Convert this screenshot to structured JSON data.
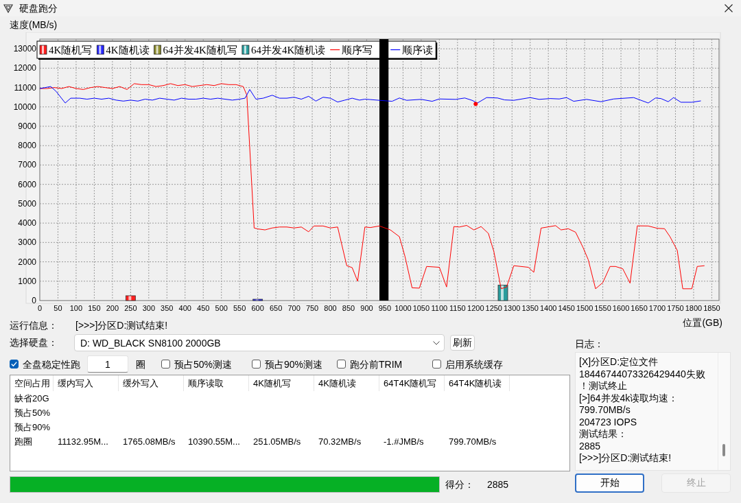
{
  "window": {
    "title": "硬盘跑分"
  },
  "chart": {
    "chart_data": [
      {
        "type": "line",
        "ylabel": "速度(MB/s)",
        "xlabel": "位置(GB)",
        "xlim": [
          0,
          1870
        ],
        "ylim": [
          0,
          13500
        ],
        "xticks": [
          0,
          50,
          100,
          150,
          200,
          250,
          300,
          350,
          400,
          450,
          500,
          550,
          600,
          650,
          700,
          750,
          800,
          850,
          900,
          950,
          1000,
          1050,
          1100,
          1150,
          1200,
          1250,
          1300,
          1350,
          1400,
          1450,
          1500,
          1550,
          1600,
          1650,
          1700,
          1750,
          1800,
          1850
        ],
        "yticks": [
          0,
          1000,
          2000,
          3000,
          4000,
          5000,
          6000,
          7000,
          8000,
          9000,
          10000,
          11000,
          12000,
          13000
        ],
        "grid": true,
        "legend": "top-left",
        "bands": [
          {
            "axis": "x",
            "from": 935,
            "to": 960,
            "color": "#000000"
          }
        ],
        "series": [
          {
            "name": "4K随机写",
            "type": "bar",
            "color": "#ff2020",
            "x": [
              250
            ],
            "values": [
              250
            ]
          },
          {
            "name": "4K随机读",
            "type": "bar",
            "color": "#2828ff",
            "x": [
              600
            ],
            "values": [
              70
            ]
          },
          {
            "name": "64并发4K随机写",
            "type": "bar",
            "color": "#8c8c30"
          },
          {
            "name": "64并发4K随机读",
            "type": "bar",
            "color": "#2a9d9d",
            "x": [
              1275
            ],
            "values": [
              800
            ]
          },
          {
            "name": "顺序写",
            "color": "#ff0000",
            "x": [
              0,
              20,
              40,
              60,
              80,
              100,
              120,
              140,
              160,
              180,
              200,
              220,
              240,
              260,
              280,
              300,
              320,
              340,
              360,
              380,
              400,
              420,
              440,
              460,
              480,
              500,
              520,
              540,
              560,
              570,
              590,
              600,
              620,
              640,
              660,
              680,
              700,
              720,
              740,
              755,
              780,
              800,
              820,
              845,
              860,
              875,
              895,
              910,
              935,
              965,
              990,
              1005,
              1025,
              1045,
              1065,
              1100,
              1120,
              1140,
              1155,
              1175,
              1195,
              1215,
              1235,
              1250,
              1270,
              1285,
              1305,
              1345,
              1360,
              1380,
              1420,
              1435,
              1455,
              1475,
              1495,
              1510,
              1530,
              1550,
              1570,
              1585,
              1605,
              1625,
              1645,
              1675,
              1700,
              1720,
              1735,
              1755,
              1770,
              1795,
              1810,
              1830
            ],
            "values": [
              10950,
              10950,
              11000,
              10950,
              11050,
              10950,
              10900,
              11000,
              11050,
              11000,
              10950,
              11050,
              10900,
              11200,
              11150,
              11150,
              11050,
              11100,
              11200,
              11100,
              11150,
              11050,
              11100,
              11150,
              11100,
              11200,
              11150,
              11150,
              11050,
              10600,
              3750,
              3700,
              3650,
              3750,
              3800,
              3800,
              3750,
              3800,
              3550,
              3850,
              3850,
              3750,
              3800,
              1800,
              1700,
              1000,
              3800,
              3770,
              3850,
              3650,
              3300,
              2300,
              660,
              640,
              1760,
              1720,
              700,
              3820,
              3800,
              3880,
              3650,
              3820,
              3470,
              2530,
              610,
              700,
              1800,
              1720,
              1460,
              3740,
              3870,
              3650,
              3710,
              3530,
              2760,
              2110,
              610,
              930,
              1760,
              1760,
              1640,
              900,
              3860,
              3850,
              3730,
              3710,
              3300,
              2590,
              610,
              610,
              1760,
              1800
            ]
          },
          {
            "name": "顺序读",
            "color": "#0000ff",
            "x": [
              0,
              15,
              30,
              45,
              70,
              85,
              110,
              130,
              150,
              170,
              190,
              210,
              230,
              250,
              270,
              290,
              310,
              330,
              350,
              370,
              390,
              410,
              430,
              450,
              470,
              490,
              510,
              530,
              550,
              565,
              578,
              595,
              615,
              640,
              660,
              680,
              700,
              720,
              740,
              760,
              780,
              800,
              820,
              840,
              860,
              880,
              895,
              910,
              935,
              970,
              990,
              1010,
              1050,
              1080,
              1100,
              1145,
              1170,
              1190,
              1205,
              1230,
              1260,
              1280,
              1305,
              1350,
              1375,
              1405,
              1430,
              1450,
              1470,
              1505,
              1545,
              1580,
              1635,
              1675,
              1695,
              1710,
              1730,
              1745,
              1765,
              1795,
              1820
            ],
            "values": [
              10950,
              11000,
              11050,
              10800,
              10200,
              10450,
              10450,
              10400,
              10450,
              10400,
              10450,
              10350,
              10300,
              10350,
              10300,
              10400,
              10350,
              10450,
              10400,
              10350,
              10450,
              10400,
              10400,
              10450,
              10400,
              10450,
              10400,
              10350,
              10400,
              10450,
              10900,
              10400,
              10450,
              10600,
              10450,
              10450,
              10500,
              10400,
              10550,
              10300,
              10500,
              10450,
              10250,
              10350,
              10450,
              10350,
              10400,
              10380,
              10340,
              10290,
              10460,
              10340,
              10390,
              10290,
              10410,
              10390,
              10460,
              10340,
              10200,
              10480,
              10460,
              10360,
              10340,
              10480,
              10390,
              10430,
              10410,
              10480,
              10290,
              10390,
              10270,
              10410,
              10480,
              10200,
              10460,
              10430,
              10270,
              10480,
              10240,
              10240,
              10310
            ]
          },
          {
            "type": "scatter",
            "color": "#ff0000",
            "x": [
              1200
            ],
            "values": [
              10150
            ]
          }
        ]
      }
    ]
  },
  "run_info": {
    "label": "运行信息：",
    "value": "[>>>]分区D:测试结束!"
  },
  "disk_select": {
    "label": "选择硬盘：",
    "value": "D: WD_BLACK SN8100 2000GB"
  },
  "refresh_button": {
    "label": "刷新"
  },
  "run_options": {
    "full_disk": {
      "label": "全盘稳定性跑",
      "checked": true
    },
    "laps": {
      "value": "1",
      "unit": "圈"
    },
    "toggles": [
      {
        "label": "预占50%测速",
        "checked": false
      },
      {
        "label": "预占90%测速",
        "checked": false
      },
      {
        "label": "跑分前TRIM",
        "checked": false
      },
      {
        "label": "启用系统缓存",
        "checked": false
      }
    ]
  },
  "results_table": {
    "columns": [
      "空间占用",
      "缓内写入",
      "缓外写入",
      "顺序读取",
      "4K随机写",
      "4K随机读",
      "64T4K随机写",
      "64T4K随机读"
    ],
    "rows": [
      {
        "cells": [
          "缺省20G"
        ]
      },
      {
        "cells": [
          "预占50%"
        ]
      },
      {
        "cells": [
          "预占90%"
        ]
      },
      {
        "cells": [
          "跑圈",
          "11132.95M...",
          "1765.08MB/s",
          "10390.55M...",
          "251.05MB/s",
          "70.32MB/s",
          "-1.#JMB/s",
          "799.70MB/s"
        ]
      }
    ]
  },
  "progress": {
    "level": 1,
    "score_label": "得分：",
    "score": "2885"
  },
  "log": {
    "label": "日志：",
    "lines": [
      "[X]分区D:定位文件",
      "18446744073326429440失败",
      "！测试终止",
      "[>]64并发4k读取均速：",
      "799.70MB/s",
      "204723 IOPS",
      "测试结果：",
      "2885",
      "[>>>]分区D:测试结束!"
    ]
  },
  "buttons": [
    {
      "label": "开始",
      "focused": true,
      "disabled": false
    },
    {
      "label": "终止",
      "focused": false,
      "disabled": true
    }
  ]
}
